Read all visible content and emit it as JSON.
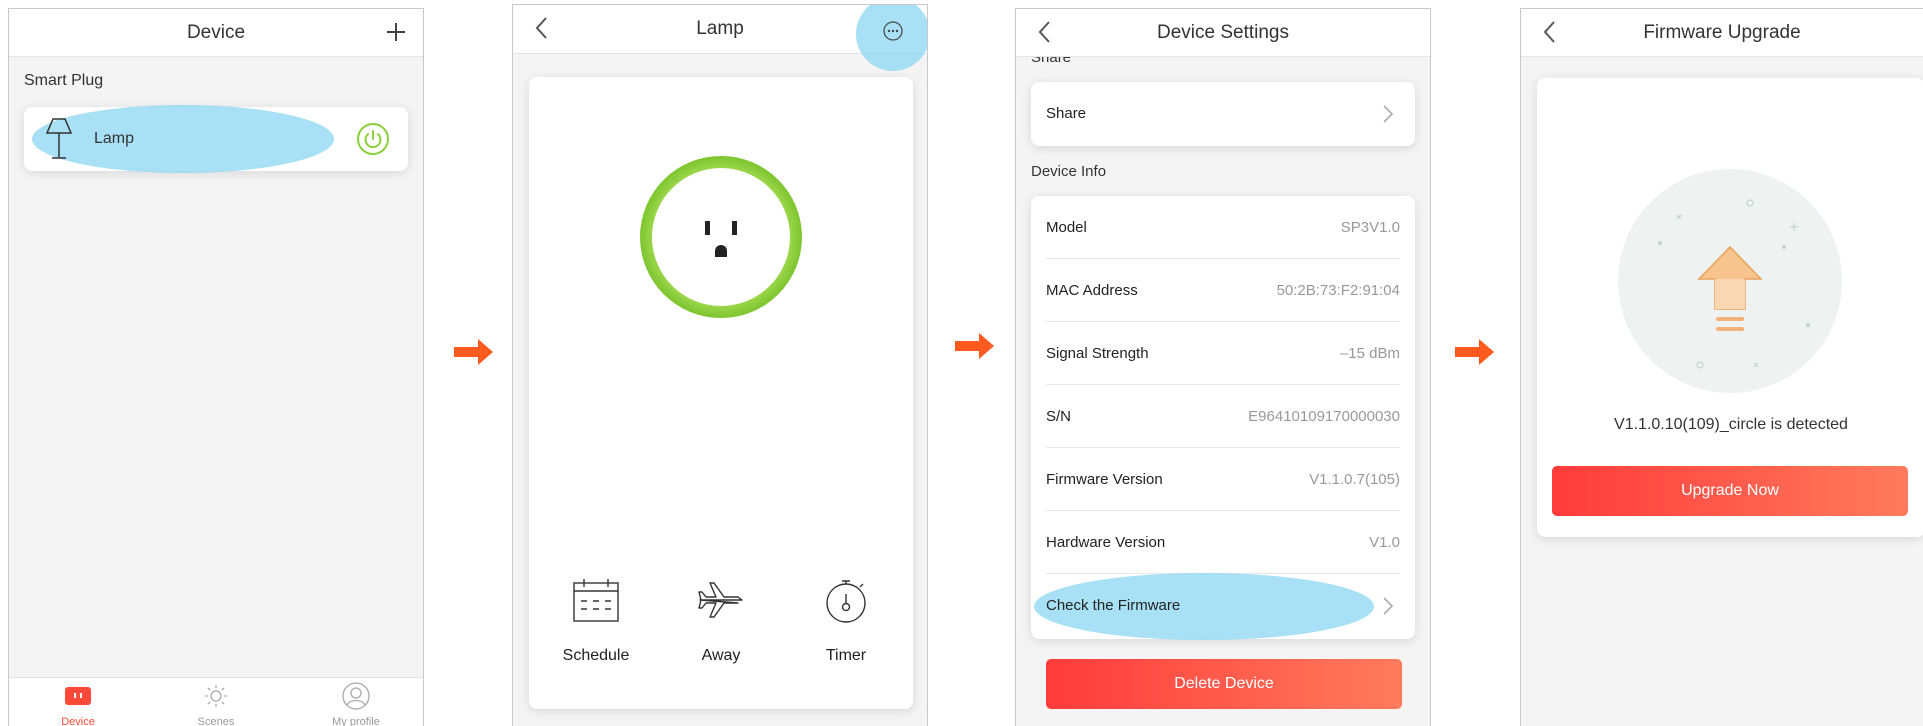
{
  "colors": {
    "accent_red": "#ff3b3b",
    "highlight_blue": "#8fd8f4",
    "arrow_orange": "#ff5a1f",
    "plug_green": "#8ccf3c"
  },
  "screen1": {
    "title": "Device",
    "add_icon": "plus-icon",
    "section": "Smart Plug",
    "device": {
      "name": "Lamp",
      "icon": "lamp-icon",
      "power_icon": "power-icon"
    },
    "tabs": [
      {
        "label": "Device",
        "icon": "plug-icon"
      },
      {
        "label": "Scenes",
        "icon": "sun-icon"
      },
      {
        "label": "My profile",
        "icon": "profile-icon"
      }
    ]
  },
  "screen2": {
    "title": "Lamp",
    "more_icon": "more-icon",
    "features": [
      {
        "label": "Schedule",
        "icon": "calendar-icon"
      },
      {
        "label": "Away",
        "icon": "airplane-icon"
      },
      {
        "label": "Timer",
        "icon": "timer-icon"
      }
    ]
  },
  "screen3": {
    "title": "Device Settings",
    "share_section": "Share",
    "share_row": "Share",
    "info_section": "Device Info",
    "rows": [
      {
        "label": "Model",
        "value": "SP3V1.0"
      },
      {
        "label": "MAC Address",
        "value": "50:2B:73:F2:91:04"
      },
      {
        "label": "Signal Strength",
        "value": "–15 dBm"
      },
      {
        "label": "S/N",
        "value": "E96410109170000030"
      },
      {
        "label": "Firmware Version",
        "value": "V1.1.0.7(105)"
      },
      {
        "label": "Hardware Version",
        "value": "V1.0"
      }
    ],
    "check_firmware": "Check the Firmware",
    "delete_button": "Delete Device"
  },
  "screen4": {
    "title": "Firmware Upgrade",
    "detected": "V1.1.0.10(109)_circle is detected",
    "upgrade_button": "Upgrade Now"
  }
}
